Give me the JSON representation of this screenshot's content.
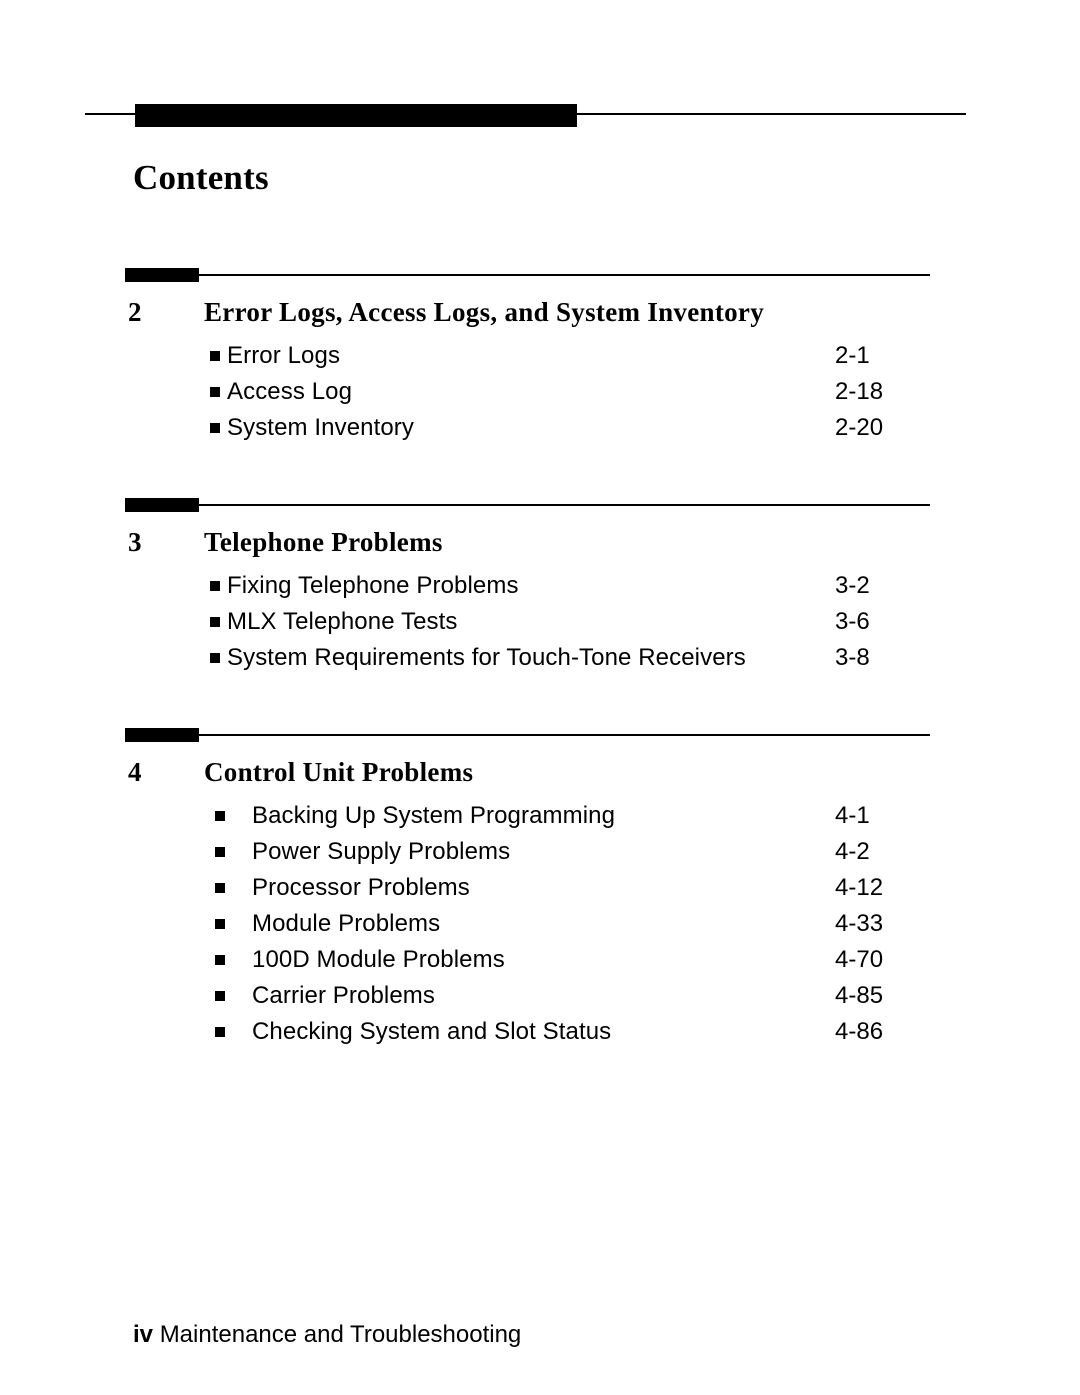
{
  "document": {
    "page_title": "Contents",
    "footer": {
      "page_number": "iv",
      "book_title": "Maintenance and Troubleshooting"
    }
  },
  "chapters": [
    {
      "number": "2",
      "title": "Error Logs, Access Logs, and System Inventory",
      "bullet_style": "tight",
      "entries": [
        {
          "label": "Error  Logs",
          "page": "2-1"
        },
        {
          "label": "Access  Log",
          "page": "2-18"
        },
        {
          "label": "System  Inventory",
          "page": "2-20"
        }
      ]
    },
    {
      "number": "3",
      "title": "Telephone Problems",
      "bullet_style": "tight",
      "entries": [
        {
          "label": "Fixing  Telephone  Problems",
          "page": "3-2"
        },
        {
          "label": "MLX  Telephone  Tests",
          "page": "3-6"
        },
        {
          "label": "System Requirements for Touch-Tone Receivers",
          "page": "3-8"
        }
      ]
    },
    {
      "number": "4",
      "title": "Control  Unit  Problems",
      "bullet_style": "wide",
      "entries": [
        {
          "label": "Backing Up System Programming",
          "page": "4-1"
        },
        {
          "label": "Power  Supply  Problems",
          "page": "4-2"
        },
        {
          "label": "Processor  Problems",
          "page": "4-12"
        },
        {
          "label": "Module  Problems",
          "page": "4-33"
        },
        {
          "label": "100D Module  Problems",
          "page": "4-70"
        },
        {
          "label": "Carrier  Problems",
          "page": "4-85"
        },
        {
          "label": "Checking System and Slot Status",
          "page": "4-86"
        }
      ]
    }
  ],
  "layout": {
    "chapter_tops": [
      268,
      498,
      728
    ]
  }
}
